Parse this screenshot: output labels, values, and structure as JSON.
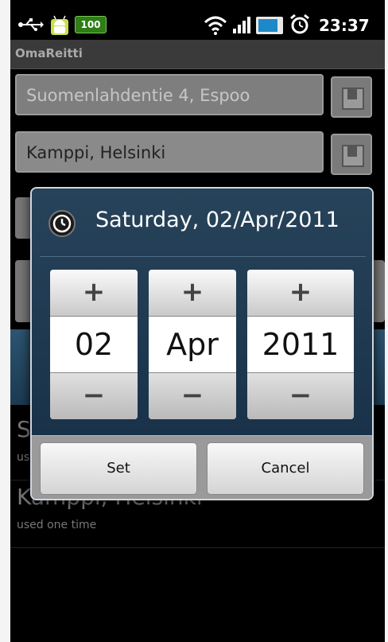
{
  "status_bar": {
    "battery_level_label": "100",
    "time": "23:37",
    "icons": [
      "usb-icon",
      "android-debug-icon",
      "battery-100-icon",
      "wifi-icon",
      "signal-icon",
      "charging-battery-icon",
      "alarm-icon"
    ]
  },
  "app": {
    "title": "OmaReitti"
  },
  "form": {
    "from_value": "Suomenlahdentie 4, Espoo",
    "to_value": "Kamppi, Helsinki"
  },
  "history": [
    {
      "title": "S",
      "subtitle": "us"
    },
    {
      "title": "Kamppi, Helsinki",
      "subtitle": "used one time"
    }
  ],
  "date_dialog": {
    "title": "Saturday, 02/Apr/2011",
    "icon": "clock-icon",
    "day": "02",
    "month": "Apr",
    "year": "2011",
    "increment_label": "+",
    "decrement_label": "−",
    "set_label": "Set",
    "cancel_label": "Cancel"
  },
  "colors": {
    "dialog_background": "#27435a",
    "title_bar": "#3a3a3a",
    "accent_blue": "#2d5470"
  }
}
